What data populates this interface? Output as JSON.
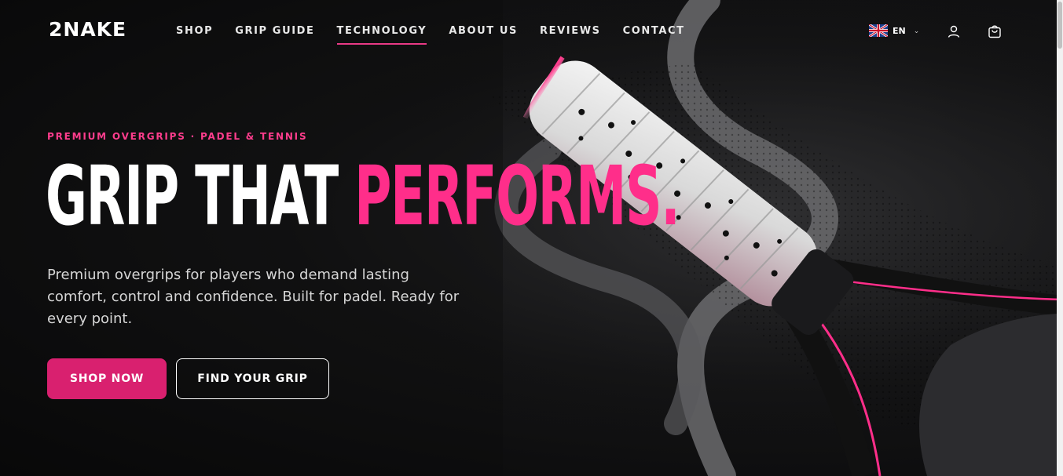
{
  "brand": {
    "logo_text": "2NAKE"
  },
  "nav": {
    "items": [
      {
        "label": "SHOP"
      },
      {
        "label": "GRIP GUIDE"
      },
      {
        "label": "TECHNOLOGY"
      },
      {
        "label": "ABOUT US"
      },
      {
        "label": "REVIEWS"
      },
      {
        "label": "CONTACT"
      }
    ],
    "active": "TECHNOLOGY"
  },
  "header": {
    "language": "EN",
    "icons": [
      "uk-flag-icon",
      "chevron-down-icon",
      "user-icon",
      "cart-icon"
    ]
  },
  "hero": {
    "eyebrow": "PREMIUM OVERGRIPS · PADEL & TENNIS",
    "headline_white": "GRIP THAT ",
    "headline_pink": "PERFORMS.",
    "lead": "Premium overgrips for players who demand lasting comfort, control and confidence. Built for padel. Ready for every point.",
    "primary_cta": "SHOP NOW",
    "secondary_cta": "FIND YOUR GRIP"
  },
  "colors": {
    "accent": "#ff2e8a",
    "button_primary": "#d9206f",
    "background": "#0b0b0c",
    "text": "#ffffff"
  }
}
